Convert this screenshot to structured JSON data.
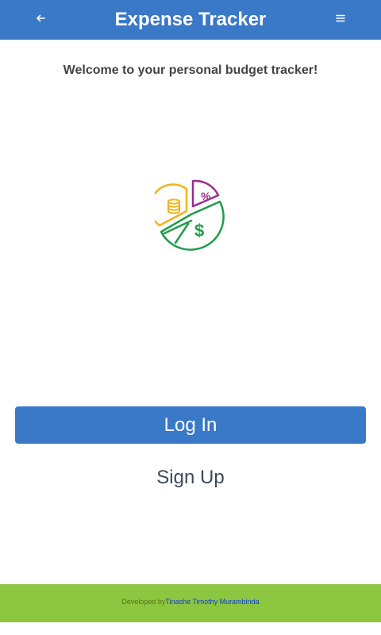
{
  "header": {
    "title": "Expense Tracker",
    "back_icon": "arrow-left-icon",
    "menu_icon": "hamburger-menu-icon",
    "background_color": "#3a78c8"
  },
  "main": {
    "welcome_text": "Welcome to your personal budget tracker!",
    "logo_icon": "pie-chart-money-icon",
    "login_label": "Log In",
    "signup_label": "Sign Up"
  },
  "footer": {
    "developed_by": "Developed by",
    "author": "Tinashe Timothy Murambinda",
    "background_color": "#8dc63f"
  }
}
